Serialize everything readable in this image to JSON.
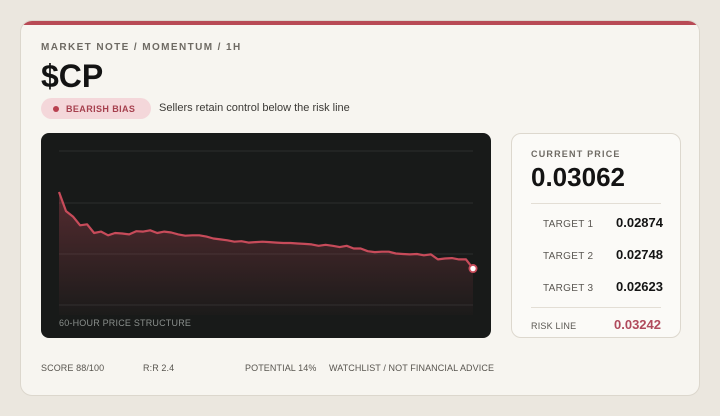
{
  "header": {
    "eyebrow": "MARKET NOTE / MOMENTUM / 1H",
    "ticker": "$CP",
    "bias_label": "BEARISH BIAS",
    "bias_note": "Sellers retain control below the risk line"
  },
  "chart": {
    "caption": "60-HOUR PRICE STRUCTURE"
  },
  "chart_data": {
    "type": "line",
    "title": "60-HOUR PRICE STRUCTURE",
    "xlabel": "",
    "ylabel": "",
    "grid": true,
    "line_color": "#c74b5a",
    "x": [
      0,
      1,
      2,
      3,
      4,
      5,
      6,
      7,
      8,
      9,
      10,
      11,
      12,
      13,
      14,
      15,
      16,
      17,
      18,
      19,
      20,
      21,
      22,
      23,
      24,
      25,
      26,
      27,
      28,
      29,
      30,
      31,
      32,
      33,
      34,
      35,
      36,
      37,
      38,
      39,
      40,
      41,
      42,
      43,
      44,
      45,
      46,
      47,
      48,
      49,
      50,
      51,
      52,
      53,
      54,
      55,
      56,
      57,
      58,
      59
    ],
    "values": [
      0.0323,
      0.03188,
      0.03176,
      0.03157,
      0.03159,
      0.0314,
      0.03143,
      0.03135,
      0.0314,
      0.03139,
      0.03137,
      0.03144,
      0.03143,
      0.03146,
      0.0314,
      0.03143,
      0.03141,
      0.03137,
      0.03134,
      0.03135,
      0.03135,
      0.03132,
      0.03128,
      0.03126,
      0.03124,
      0.03121,
      0.03122,
      0.03119,
      0.0312,
      0.03121,
      0.0312,
      0.03119,
      0.03118,
      0.03118,
      0.03117,
      0.03116,
      0.03115,
      0.03112,
      0.03114,
      0.03112,
      0.03109,
      0.03112,
      0.03106,
      0.03106,
      0.031,
      0.03098,
      0.03099,
      0.03099,
      0.03095,
      0.03094,
      0.03093,
      0.03094,
      0.03091,
      0.03093,
      0.03082,
      0.03084,
      0.03085,
      0.03082,
      0.03082,
      0.03062
    ],
    "ylim": [
      0.0296,
      0.0332
    ]
  },
  "price_card": {
    "label": "CURRENT PRICE",
    "value": "0.03062",
    "targets": [
      {
        "label": "TARGET 1",
        "value": "0.02874"
      },
      {
        "label": "TARGET 2",
        "value": "0.02748"
      },
      {
        "label": "TARGET 3",
        "value": "0.02623"
      }
    ],
    "risk_label": "RISK LINE",
    "risk_value": "0.03242"
  },
  "footer": {
    "score": "SCORE 88/100",
    "rr": "R:R 2.4",
    "potential": "POTENTIAL 14%",
    "disclaimer": "WATCHLIST / NOT FINANCIAL ADVICE"
  },
  "colors": {
    "accent": "#b84a55",
    "bias_bg": "#f4d7da",
    "chart_bg": "#181a19",
    "risk": "#b04a5c"
  }
}
